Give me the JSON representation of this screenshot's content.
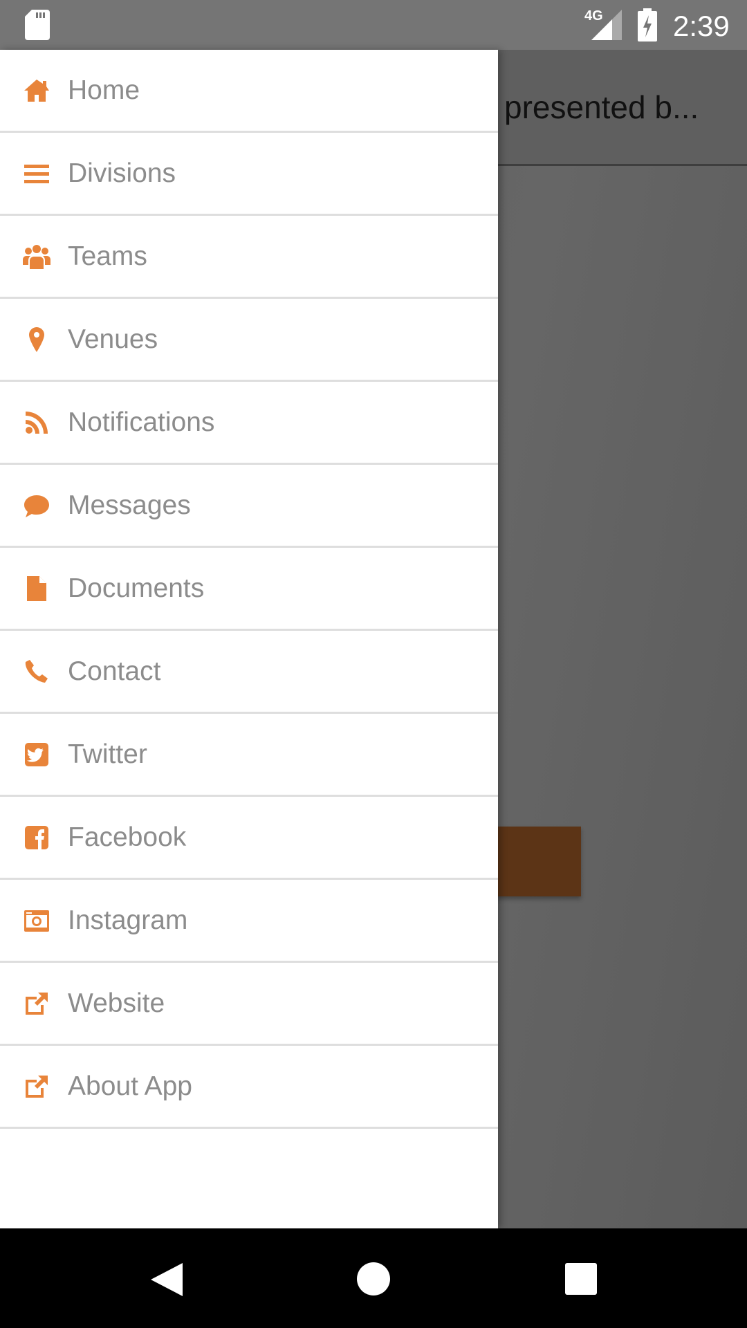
{
  "status_bar": {
    "time": "2:39",
    "network": "4G",
    "icons": [
      "sd-card-icon",
      "signal-icon",
      "battery-charging-icon"
    ]
  },
  "background": {
    "toolbar_title": "presented b..."
  },
  "colors": {
    "accent": "#e8843a",
    "label": "#8c8c8c",
    "brown": "#5c3416"
  },
  "drawer": {
    "items": [
      {
        "label": "Home",
        "icon": "home-icon"
      },
      {
        "label": "Divisions",
        "icon": "list-icon"
      },
      {
        "label": "Teams",
        "icon": "users-icon"
      },
      {
        "label": "Venues",
        "icon": "map-marker-icon"
      },
      {
        "label": "Notifications",
        "icon": "rss-icon"
      },
      {
        "label": "Messages",
        "icon": "comment-icon"
      },
      {
        "label": "Documents",
        "icon": "file-icon"
      },
      {
        "label": "Contact",
        "icon": "phone-icon"
      },
      {
        "label": "Twitter",
        "icon": "twitter-icon"
      },
      {
        "label": "Facebook",
        "icon": "facebook-icon"
      },
      {
        "label": "Instagram",
        "icon": "instagram-icon"
      },
      {
        "label": "Website",
        "icon": "external-link-icon"
      },
      {
        "label": "About App",
        "icon": "external-link-icon"
      }
    ]
  },
  "nav_bar": {
    "buttons": [
      "back",
      "home",
      "recents"
    ]
  }
}
